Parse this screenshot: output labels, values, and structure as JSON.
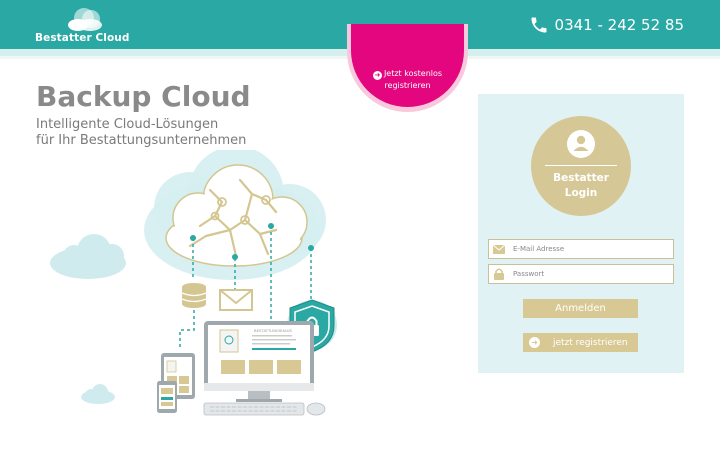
{
  "header": {
    "logo_text": "Bestatter Cloud",
    "phone": "0341 - 242 52 85"
  },
  "badge": {
    "line1": "Jetzt kostenlos",
    "line2": "registrieren"
  },
  "hero": {
    "title": "Backup Cloud",
    "subtitle_line1": "Intelligente Cloud-Lösungen",
    "subtitle_line2": "für Ihr Bestattungsunternehmen"
  },
  "illustration": {
    "monitor_heading": "BESTATTUNGSHAUS"
  },
  "login": {
    "title_line1": "Bestatter",
    "title_line2": "Login",
    "email_placeholder": "E-Mail Adresse",
    "password_placeholder": "Passwort",
    "login_button": "Anmelden",
    "register_button": "jetzt registrieren"
  },
  "colors": {
    "header": "#2aa8a3",
    "accent_pink": "#e4067e",
    "gold": "#d8c994",
    "panel_bg": "#e0f2f3"
  }
}
